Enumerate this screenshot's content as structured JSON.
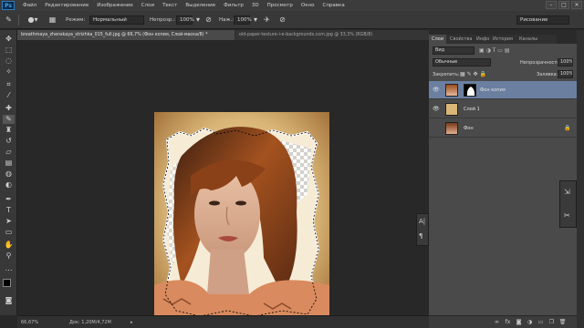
{
  "app": {
    "logo": "Ps",
    "menu": [
      "Файл",
      "Редактирование",
      "Изображение",
      "Слои",
      "Текст",
      "Выделение",
      "Фильтр",
      "3D",
      "Просмотр",
      "Окно",
      "Справка"
    ],
    "window_controls": [
      "–",
      "□",
      "✕"
    ]
  },
  "options": {
    "mode_label": "Режим:",
    "mode_value": "Нормальный",
    "opacity_label": "Непрозр.:",
    "opacity_value": "100%",
    "flow_label": "Наж.:",
    "flow_value": "100%",
    "workspace_value": "Рисование"
  },
  "tabs": [
    {
      "label": "breathmaya_zhenskaya_strizhka_015_full.jpg @ 66,7% (Фон копия, Слой-маска/8) *",
      "active": true
    },
    {
      "label": "old-paper-texture-i-e-backgrounds.com.jpg @ 33,3% (RGB/8)",
      "active": false
    }
  ],
  "status": {
    "zoom": "66,67%",
    "doc_size": "Док: 1,20M/4,72M"
  },
  "panels": {
    "tabs": [
      "Слои",
      "Свойства",
      "Инфо",
      "История",
      "Каналы"
    ],
    "kind_value": "Вид",
    "blend_value": "Обычные",
    "opacity_label": "Непрозрачность:",
    "opacity_value": "100%",
    "lock_label": "Закрепить:",
    "fill_label": "Заливка:",
    "fill_value": "100%",
    "layers": [
      {
        "name": "Фон копия",
        "selected": true,
        "has_mask": true,
        "visible": true
      },
      {
        "name": "Слой 1",
        "selected": false,
        "has_mask": false,
        "visible": true
      },
      {
        "name": "Фон",
        "selected": false,
        "has_mask": false,
        "visible": false,
        "locked": true
      }
    ]
  },
  "colors": {
    "accent": "#6b7fa0",
    "panel_bg": "#4a4a4a",
    "ui_dark": "#282828"
  }
}
